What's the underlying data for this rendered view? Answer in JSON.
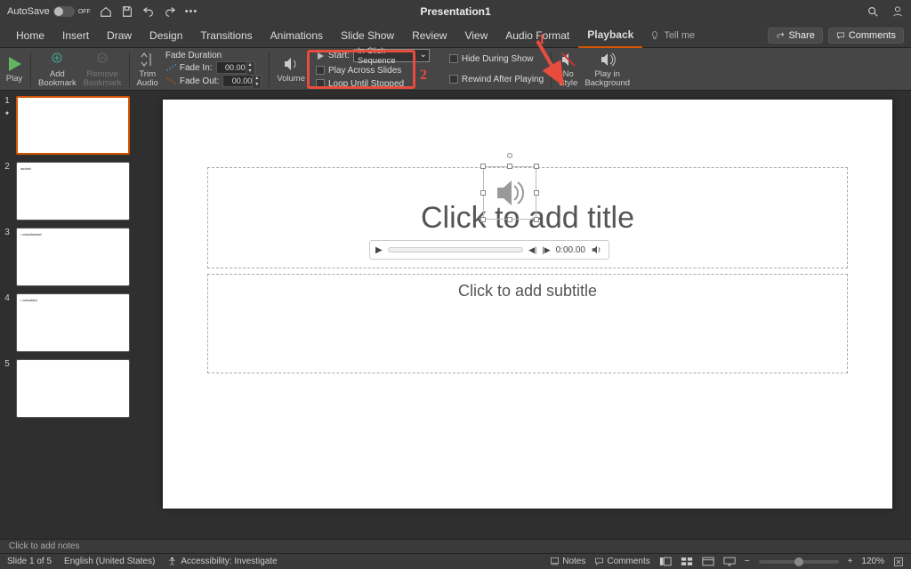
{
  "titlebar": {
    "autosave_label": "AutoSave",
    "autosave_state": "OFF",
    "title": "Presentation1"
  },
  "tabs": {
    "items": [
      "Home",
      "Insert",
      "Draw",
      "Design",
      "Transitions",
      "Animations",
      "Slide Show",
      "Review",
      "View",
      "Audio Format",
      "Playback"
    ],
    "active": "Playback",
    "tell_me": "Tell me",
    "share": "Share",
    "comments": "Comments"
  },
  "ribbon": {
    "play": "Play",
    "add_bookmark": "Add\nBookmark",
    "remove_bookmark": "Remove\nBookmark",
    "trim_audio": "Trim\nAudio",
    "fade_duration": "Fade Duration",
    "fade_in": "Fade In:",
    "fade_out": "Fade Out:",
    "fade_in_val": "00.00",
    "fade_out_val": "00.00",
    "volume": "Volume",
    "start_label": "Start:",
    "start_value": "In Click Sequence",
    "play_across": "Play Across Slides",
    "loop": "Loop Until Stopped",
    "hide_during": "Hide During Show",
    "rewind_after": "Rewind After Playing",
    "no_style": "No\nStyle",
    "play_bg": "Play in\nBackground"
  },
  "annotations": {
    "one": "1",
    "two": "2"
  },
  "thumbs": {
    "count": 5,
    "texts": [
      "",
      "asdasf",
      "• sfassfasfasf",
      "• asfsafafa",
      ""
    ]
  },
  "slide": {
    "title_placeholder": "Click to add title",
    "subtitle_placeholder": "Click to add subtitle",
    "player_time": "0:00.00"
  },
  "notes": {
    "placeholder": "Click to add notes"
  },
  "status": {
    "slide_of": "Slide 1 of 5",
    "lang": "English (United States)",
    "accessibility": "Accessibility: Investigate",
    "notes_btn": "Notes",
    "comments_btn": "Comments",
    "zoom": "120%"
  }
}
